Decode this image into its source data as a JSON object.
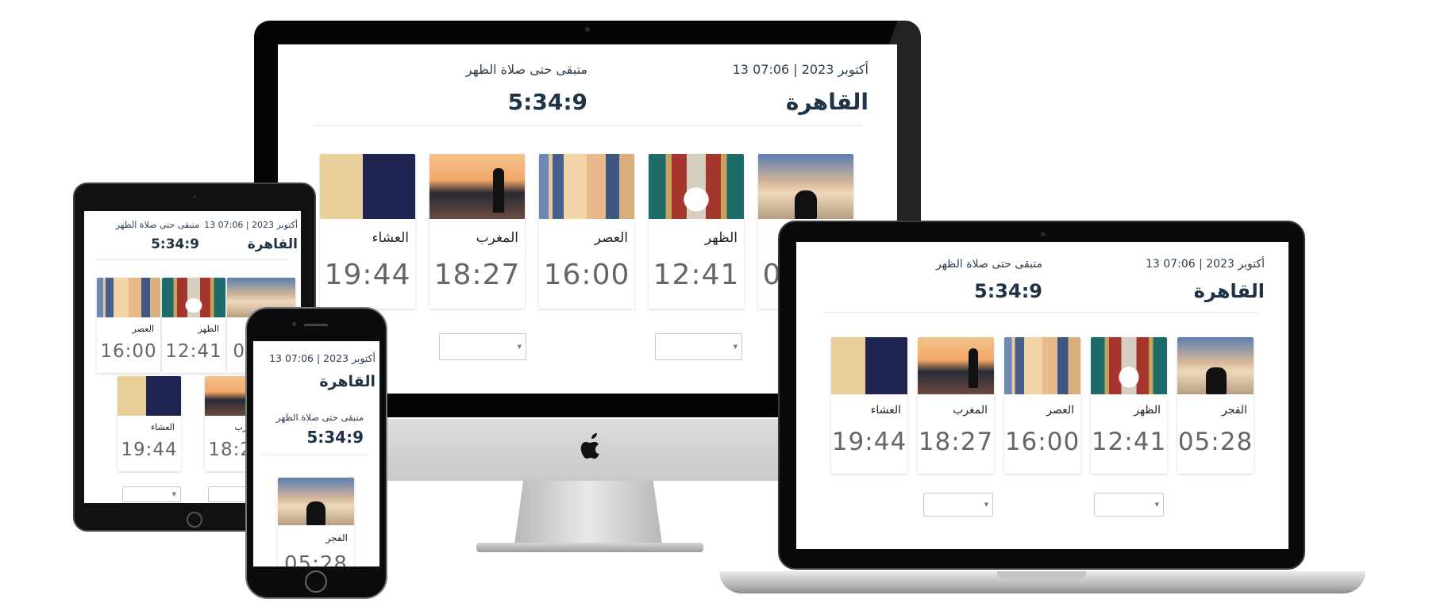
{
  "header": {
    "date_time": "13 أكتوبر 2023 | 07:06",
    "city": "القاهرة",
    "remaining_label": "متبقى حتى صلاة الظهر",
    "countdown": "5:34:9"
  },
  "prayers": [
    {
      "name": "الفجر",
      "time": "05:28",
      "image": "fajr"
    },
    {
      "name": "الظهر",
      "time": "12:41",
      "image": "dhuhr"
    },
    {
      "name": "العصر",
      "time": "16:00",
      "image": "asr"
    },
    {
      "name": "المغرب",
      "time": "18:27",
      "image": "maghrib"
    },
    {
      "name": "العشاء",
      "time": "19:44",
      "image": "isha"
    }
  ],
  "colors": {
    "text": "#2c3e50",
    "heading": "#1f3347",
    "time": "#666666"
  },
  "icons": {
    "apple": "apple-logo-icon",
    "select_caret": "caret-down-icon"
  }
}
